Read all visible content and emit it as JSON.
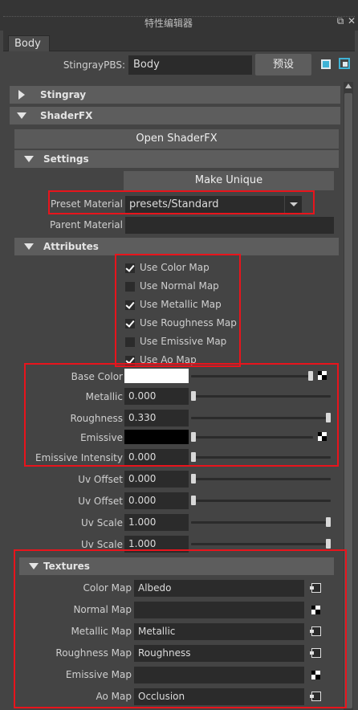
{
  "window": {
    "title": "特性编辑器",
    "float_glyph": "⧉",
    "close_glyph": "✕"
  },
  "tab": {
    "label": "Body"
  },
  "node": {
    "type_label": "StingrayPBS:",
    "name": "Body",
    "preset_button": "预设"
  },
  "sections": {
    "stingray": "Stingray",
    "shaderfx": "ShaderFX",
    "settings": "Settings",
    "attributes": "Attributes",
    "textures": "Textures"
  },
  "buttons": {
    "open_shaderfx": "Open ShaderFX",
    "make_unique": "Make Unique"
  },
  "settings": {
    "preset_label": "Preset Material",
    "preset_value": "presets/Standard",
    "parent_label": "Parent Material",
    "parent_value": ""
  },
  "checkboxes": [
    {
      "label": "Use Color Map",
      "checked": true
    },
    {
      "label": "Use Normal Map",
      "checked": false
    },
    {
      "label": "Use Metallic Map",
      "checked": true
    },
    {
      "label": "Use Roughness Map",
      "checked": true
    },
    {
      "label": "Use Emissive Map",
      "checked": false
    },
    {
      "label": "Use Ao Map",
      "checked": true
    }
  ],
  "attributes": [
    {
      "label": "Base Color",
      "kind": "color",
      "color": "#ffffff",
      "level": 1.0,
      "map": true
    },
    {
      "label": "Metallic",
      "kind": "number",
      "value": "0.000",
      "level": 0.0
    },
    {
      "label": "Roughness",
      "kind": "number",
      "value": "0.330",
      "level": 1.0
    },
    {
      "label": "Emissive",
      "kind": "color",
      "color": "#000000",
      "level": 0.0,
      "map": true
    },
    {
      "label": "Emissive Intensity",
      "kind": "number",
      "value": "0.000",
      "level": 0.0
    },
    {
      "label": "Uv Offset",
      "kind": "number",
      "value": "0.000",
      "level": 0.0
    },
    {
      "label": "Uv Offset",
      "kind": "number",
      "value": "0.000",
      "level": 0.0
    },
    {
      "label": "Uv Scale",
      "kind": "number",
      "value": "1.000",
      "level": 1.0
    },
    {
      "label": "Uv Scale",
      "kind": "number",
      "value": "1.000",
      "level": 1.0
    }
  ],
  "textures": [
    {
      "label": "Color Map",
      "value": "Albedo",
      "connected": true
    },
    {
      "label": "Normal Map",
      "value": "",
      "connected": false
    },
    {
      "label": "Metallic Map",
      "value": "Metallic",
      "connected": true
    },
    {
      "label": "Roughness Map",
      "value": "Roughness",
      "connected": true
    },
    {
      "label": "Emissive Map",
      "value": "",
      "connected": false
    },
    {
      "label": "Ao Map",
      "value": "Occlusion",
      "connected": true
    }
  ],
  "colors": {
    "highlight": "#e8141c",
    "panel": "#444444",
    "field": "#2b2b2b",
    "header": "#5d5d5d"
  }
}
